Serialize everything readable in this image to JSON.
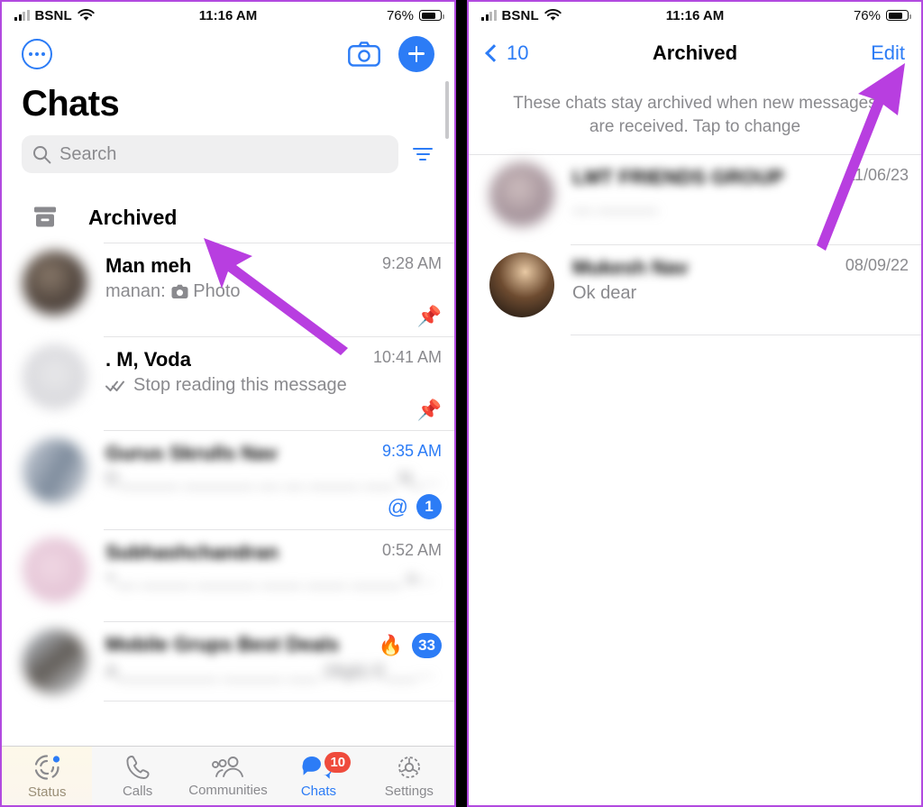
{
  "status_bar": {
    "carrier": "BSNL",
    "wifi_icon": "wifi-icon",
    "signal_icon": "cellular-signal-icon",
    "time": "11:16 AM",
    "battery_percent": "76%",
    "battery_icon": "battery-icon"
  },
  "left_panel": {
    "nav": {
      "more_icon": "more-options-icon",
      "camera_icon": "camera-icon",
      "new_chat_icon": "plus-icon"
    },
    "page_title": "Chats",
    "search": {
      "placeholder": "Search",
      "search_icon": "search-icon",
      "filter_icon": "filter-icon"
    },
    "archived_entry": {
      "label": "Archived",
      "icon": "archive-box-icon"
    },
    "chats": [
      {
        "name": "Man meh",
        "preview_prefix": "manan:",
        "preview": "Photo",
        "preview_icon": "photo-camera-icon",
        "time": "9:28 AM",
        "time_color": "#8a8a8e",
        "pinned": true,
        "pin_icon": "pin-icon",
        "blurred_name": false,
        "blurred_preview": false,
        "badge": "",
        "mention": false
      },
      {
        "name": ". M, Voda",
        "preview_prefix": "",
        "preview": "Stop reading this message",
        "preview_icon": "read-receipt-double-check-icon",
        "time": "10:41 AM",
        "time_color": "#8a8a8e",
        "pinned": true,
        "pin_icon": "pin-icon",
        "blurred_name": false,
        "blurred_preview": false,
        "badge": "",
        "mention": false
      },
      {
        "name": "Gurus Skrulls Nav",
        "preview_prefix": "",
        "preview": "D______ _______ __ __ _____ ___ N_____ ____",
        "preview_icon": "",
        "time": "9:35 AM",
        "time_color": "#2c7cf6",
        "pinned": false,
        "pin_icon": "",
        "blurred_name": true,
        "blurred_preview": true,
        "badge": "1",
        "mention": true,
        "mention_icon": "at-mention-icon"
      },
      {
        "name": "Subhashchandran",
        "preview_prefix": "",
        "preview": "+__ _____ ______ ____ ____ _____ using t__ ______ __ ___ ___",
        "preview_icon": "",
        "time": "0:52 AM",
        "time_color": "#8a8a8e",
        "pinned": false,
        "pin_icon": "",
        "blurred_name": true,
        "blurred_preview": true,
        "badge": "",
        "mention": false
      },
      {
        "name": "Mobile Grups Best Deals",
        "preview_prefix": "",
        "preview": "A__________ ______ ___ 28gb) E______ ________ ____ ___ ce id o...",
        "preview_icon": "fire-emoji",
        "time": "",
        "time_color": "#8a8a8e",
        "pinned": false,
        "pin_icon": "",
        "blurred_name": true,
        "blurred_preview": true,
        "badge": "33",
        "mention": false
      }
    ],
    "tabs": [
      {
        "label": "Status",
        "icon": "status-rings-icon",
        "active": false,
        "badge": "",
        "dot": true
      },
      {
        "label": "Calls",
        "icon": "phone-icon",
        "active": false,
        "badge": "",
        "dot": false
      },
      {
        "label": "Communities",
        "icon": "communities-people-icon",
        "active": false,
        "badge": "",
        "dot": false
      },
      {
        "label": "Chats",
        "icon": "chat-bubbles-icon",
        "active": true,
        "badge": "10",
        "dot": false
      },
      {
        "label": "Settings",
        "icon": "gear-icon",
        "active": false,
        "badge": "",
        "dot": false
      }
    ]
  },
  "right_panel": {
    "back_label": "10",
    "back_icon": "chevron-left-icon",
    "title": "Archived",
    "edit_label": "Edit",
    "note": "These chats stay archived when new messages are received. Tap to change",
    "chats": [
      {
        "name": "LMT FRIENDS GROUP",
        "preview": "__ ______",
        "date": "11/06/23",
        "blurred_name": true,
        "blurred_preview": true
      },
      {
        "name": "Mukesh Nav",
        "preview": "Ok dear",
        "date": "08/09/22",
        "blurred_name": true,
        "blurred_preview": false
      }
    ]
  },
  "annotations": {
    "arrow_color": "#b83ee0",
    "arrows": [
      {
        "name": "arrow-pointing-to-archived",
        "target": "Archived"
      },
      {
        "name": "arrow-pointing-to-edit",
        "target": "Edit"
      }
    ]
  },
  "theme": {
    "accent_blue": "#2c7cf6",
    "badge_red": "#ef4b3c",
    "muted_gray": "#8a8a8e",
    "separator": "#e4e4e6",
    "frame_purple": "#b24ae0"
  }
}
